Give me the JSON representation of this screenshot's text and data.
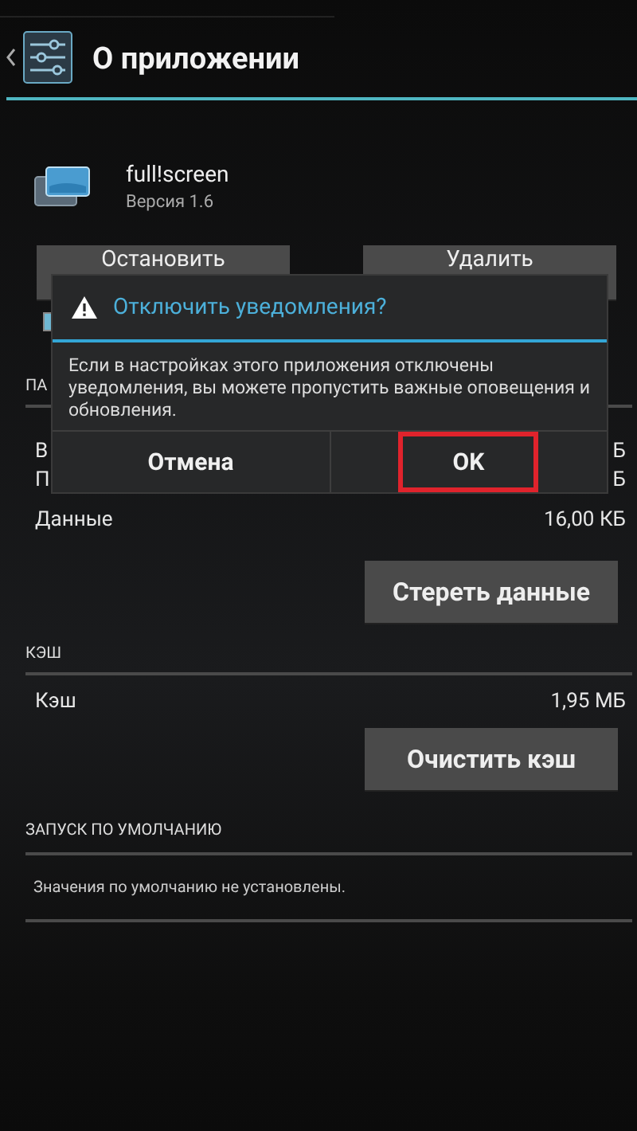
{
  "action_bar": {
    "title": "О приложении"
  },
  "app": {
    "name": "full!screen",
    "version": "Версия 1.6"
  },
  "app_buttons": [
    {
      "label": "Остановить"
    },
    {
      "label": "Удалить"
    }
  ],
  "notifications_checkbox": {
    "checked": true
  },
  "storage_header": "ПА",
  "covered_rows": [
    {
      "label": "В",
      "value": "Б"
    },
    {
      "label": "П",
      "value": "Б"
    }
  ],
  "data_row": {
    "label": "Данные",
    "value": "16,00 КБ"
  },
  "clear_data_button": "Стереть данные",
  "cache_header": "КЭШ",
  "cache_row": {
    "label": "Кэш",
    "value": "1,95 МБ"
  },
  "clear_cache_button": "Очистить кэш",
  "launch_header": "ЗАПУСК ПО УМОЛЧАНИЮ",
  "launch_text": "Значения по умолчанию не установлены.",
  "dialog": {
    "title": "Отключить уведомления?",
    "message": "Если в настройках этого приложения отключены уведомления, вы можете пропустить важные оповещения и обновления.",
    "buttons": [
      {
        "label": "Отмена",
        "highlighted": false
      },
      {
        "label": "OK",
        "highlighted": true
      }
    ]
  }
}
